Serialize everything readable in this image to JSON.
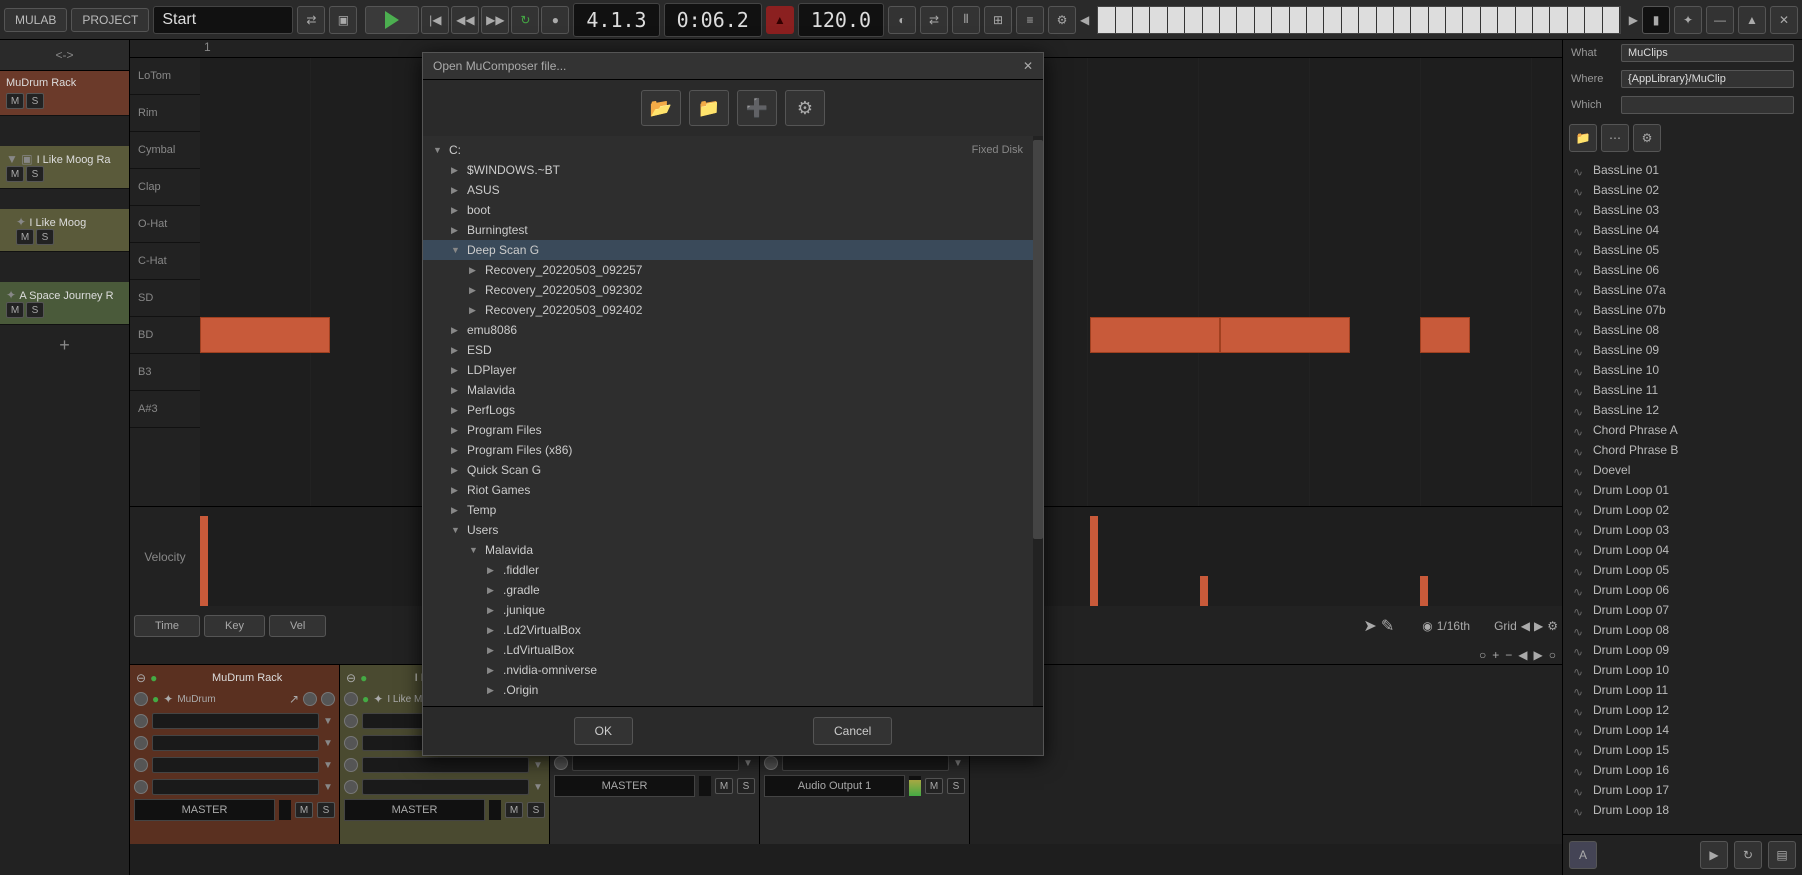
{
  "topbar": {
    "mulab": "MULAB",
    "project": "PROJECT",
    "start": "Start",
    "position": "4.1.3",
    "time": "0:06.2",
    "bpm": "120.0"
  },
  "tracks": {
    "header": "<->",
    "items": [
      {
        "name": "MuDrum Rack"
      },
      {
        "name": "I Like Moog Ra"
      },
      {
        "name": "I Like Moog"
      },
      {
        "name": "A Space Journey R"
      }
    ],
    "mute": "M",
    "solo": "S"
  },
  "drum_lanes": [
    "LoTom",
    "Rim",
    "Cymbal",
    "Clap",
    "O-Hat",
    "C-Hat",
    "SD",
    "BD",
    "B3",
    "A#3"
  ],
  "velocity_label": "Velocity",
  "ruler_start": "1",
  "editor_controls": {
    "time": "Time",
    "key": "Key",
    "vel": "Vel",
    "grid": "Grid",
    "grid_value": "1/16th"
  },
  "mixer": {
    "strips": [
      {
        "name": "MuDrum Rack",
        "plugin": "MuDrum",
        "master": "MASTER"
      },
      {
        "name": "I Like Moog Rack",
        "plugin": "I Like Moog",
        "master": "MASTER"
      },
      {
        "name": "",
        "plugin": "",
        "master": "MASTER"
      },
      {
        "name": "",
        "plugin": "",
        "master": "Audio Output 1"
      }
    ],
    "mute": "M",
    "solo": "S"
  },
  "browser": {
    "what_label": "What",
    "what_value": "MuClips",
    "where_label": "Where",
    "where_value": "{AppLibrary}/MuClip",
    "which_label": "Which",
    "which_value": "",
    "items": [
      "BassLine 01",
      "BassLine 02",
      "BassLine 03",
      "BassLine 04",
      "BassLine 05",
      "BassLine 06",
      "BassLine 07a",
      "BassLine 07b",
      "BassLine 08",
      "BassLine 09",
      "BassLine 10",
      "BassLine 11",
      "BassLine 12",
      "Chord Phrase A",
      "Chord Phrase B",
      "Doevel",
      "Drum Loop 01",
      "Drum Loop 02",
      "Drum Loop 03",
      "Drum Loop 04",
      "Drum Loop 05",
      "Drum Loop 06",
      "Drum Loop 07",
      "Drum Loop 08",
      "Drum Loop 09",
      "Drum Loop 10",
      "Drum Loop 11",
      "Drum Loop 12",
      "Drum Loop 14",
      "Drum Loop 15",
      "Drum Loop 16",
      "Drum Loop 17",
      "Drum Loop 18"
    ],
    "footer_a": "A"
  },
  "dialog": {
    "title": "Open MuComposer file...",
    "ok": "OK",
    "cancel": "Cancel",
    "disk_label": "Fixed Disk",
    "tree": [
      {
        "label": "C:",
        "depth": 0,
        "arrow": "▼",
        "right": "Fixed Disk"
      },
      {
        "label": "$WINDOWS.~BT",
        "depth": 1,
        "arrow": "▶"
      },
      {
        "label": "ASUS",
        "depth": 1,
        "arrow": "▶"
      },
      {
        "label": "boot",
        "depth": 1,
        "arrow": "▶"
      },
      {
        "label": "Burningtest",
        "depth": 1,
        "arrow": "▶"
      },
      {
        "label": "Deep Scan G",
        "depth": 1,
        "arrow": "▼",
        "selected": true
      },
      {
        "label": "Recovery_20220503_092257",
        "depth": 2,
        "arrow": "▶"
      },
      {
        "label": "Recovery_20220503_092302",
        "depth": 2,
        "arrow": "▶"
      },
      {
        "label": "Recovery_20220503_092402",
        "depth": 2,
        "arrow": "▶"
      },
      {
        "label": "emu8086",
        "depth": 1,
        "arrow": "▶"
      },
      {
        "label": "ESD",
        "depth": 1,
        "arrow": "▶"
      },
      {
        "label": "LDPlayer",
        "depth": 1,
        "arrow": "▶"
      },
      {
        "label": "Malavida",
        "depth": 1,
        "arrow": "▶"
      },
      {
        "label": "PerfLogs",
        "depth": 1,
        "arrow": "▶"
      },
      {
        "label": "Program Files",
        "depth": 1,
        "arrow": "▶"
      },
      {
        "label": "Program Files (x86)",
        "depth": 1,
        "arrow": "▶"
      },
      {
        "label": "Quick Scan G",
        "depth": 1,
        "arrow": "▶"
      },
      {
        "label": "Riot Games",
        "depth": 1,
        "arrow": "▶"
      },
      {
        "label": "Temp",
        "depth": 1,
        "arrow": "▶"
      },
      {
        "label": "Users",
        "depth": 1,
        "arrow": "▼"
      },
      {
        "label": "Malavida",
        "depth": 2,
        "arrow": "▼"
      },
      {
        "label": ".fiddler",
        "depth": 3,
        "arrow": "▶"
      },
      {
        "label": ".gradle",
        "depth": 3,
        "arrow": "▶"
      },
      {
        "label": ".junique",
        "depth": 3,
        "arrow": "▶"
      },
      {
        "label": ".Ld2VirtualBox",
        "depth": 3,
        "arrow": "▶"
      },
      {
        "label": ".LdVirtualBox",
        "depth": 3,
        "arrow": "▶"
      },
      {
        "label": ".nvidia-omniverse",
        "depth": 3,
        "arrow": "▶"
      },
      {
        "label": ".Origin",
        "depth": 3,
        "arrow": "▶"
      }
    ]
  }
}
